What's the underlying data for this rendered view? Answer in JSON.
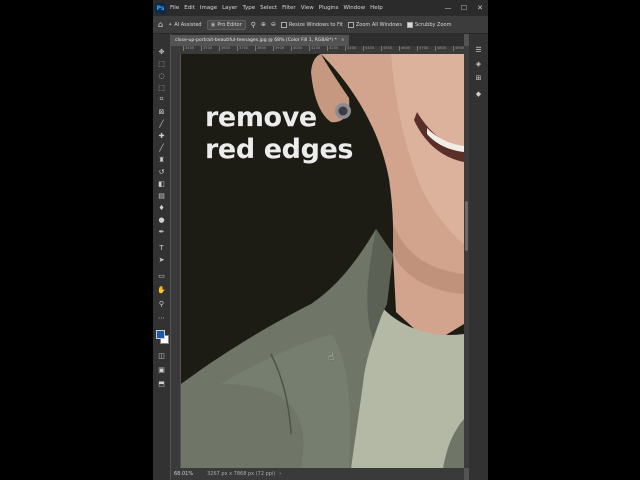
{
  "app": {
    "logo": "Ps"
  },
  "menu": [
    "File",
    "Edit",
    "Image",
    "Layer",
    "Type",
    "Select",
    "Filter",
    "View",
    "Plugins",
    "Window",
    "Help"
  ],
  "window_controls": [
    "—",
    "☐",
    "✕"
  ],
  "options": {
    "ai_assisted": "AI Assisted",
    "pro_editor": "Pro Editor",
    "resize_windows": "Resize Windows to Fit",
    "zoom_all": "Zoom All Windows",
    "scrubby_zoom": "Scrubby Zoom"
  },
  "document": {
    "tab_title": "close-up-portrait-beautiful-teenages.jpg @ 68% (Color Fill 1, RGB/8*) *",
    "close": "×"
  },
  "ruler": {
    "top_labels": [
      "3400",
      "3500",
      "3600",
      "3700",
      "3800",
      "3900",
      "4000",
      "4100",
      "4200",
      "4300",
      "4400",
      "4500",
      "4600",
      "4700",
      "4800",
      "4900"
    ]
  },
  "overlay": {
    "line1": "remove",
    "line2": "red edges"
  },
  "status": {
    "zoom": "68.01%",
    "doc_info": "3267 px x 7868 px (72 ppi)",
    "arrow": "›"
  },
  "colors": {
    "background": "#1d1c14",
    "jacket": "#6f7668",
    "tshirt": "#b4b9a6",
    "skin": "#d6aa92",
    "accent": "#31a8ff"
  },
  "tools": [
    "move-icon",
    "marquee-icon",
    "lasso-icon",
    "object-select-icon",
    "crop-icon",
    "frame-icon",
    "eyedropper-icon",
    "healing-icon",
    "brush-icon",
    "stamp-icon",
    "history-brush-icon",
    "eraser-icon",
    "gradient-icon",
    "blur-icon",
    "dodge-icon",
    "pen-icon",
    "type-icon",
    "path-select-icon",
    "rectangle-icon",
    "hand-icon",
    "zoom-icon",
    "more-icon",
    "color-swatches",
    "quick-mask-icon",
    "screen-mode-icon",
    "artboard-icon"
  ]
}
